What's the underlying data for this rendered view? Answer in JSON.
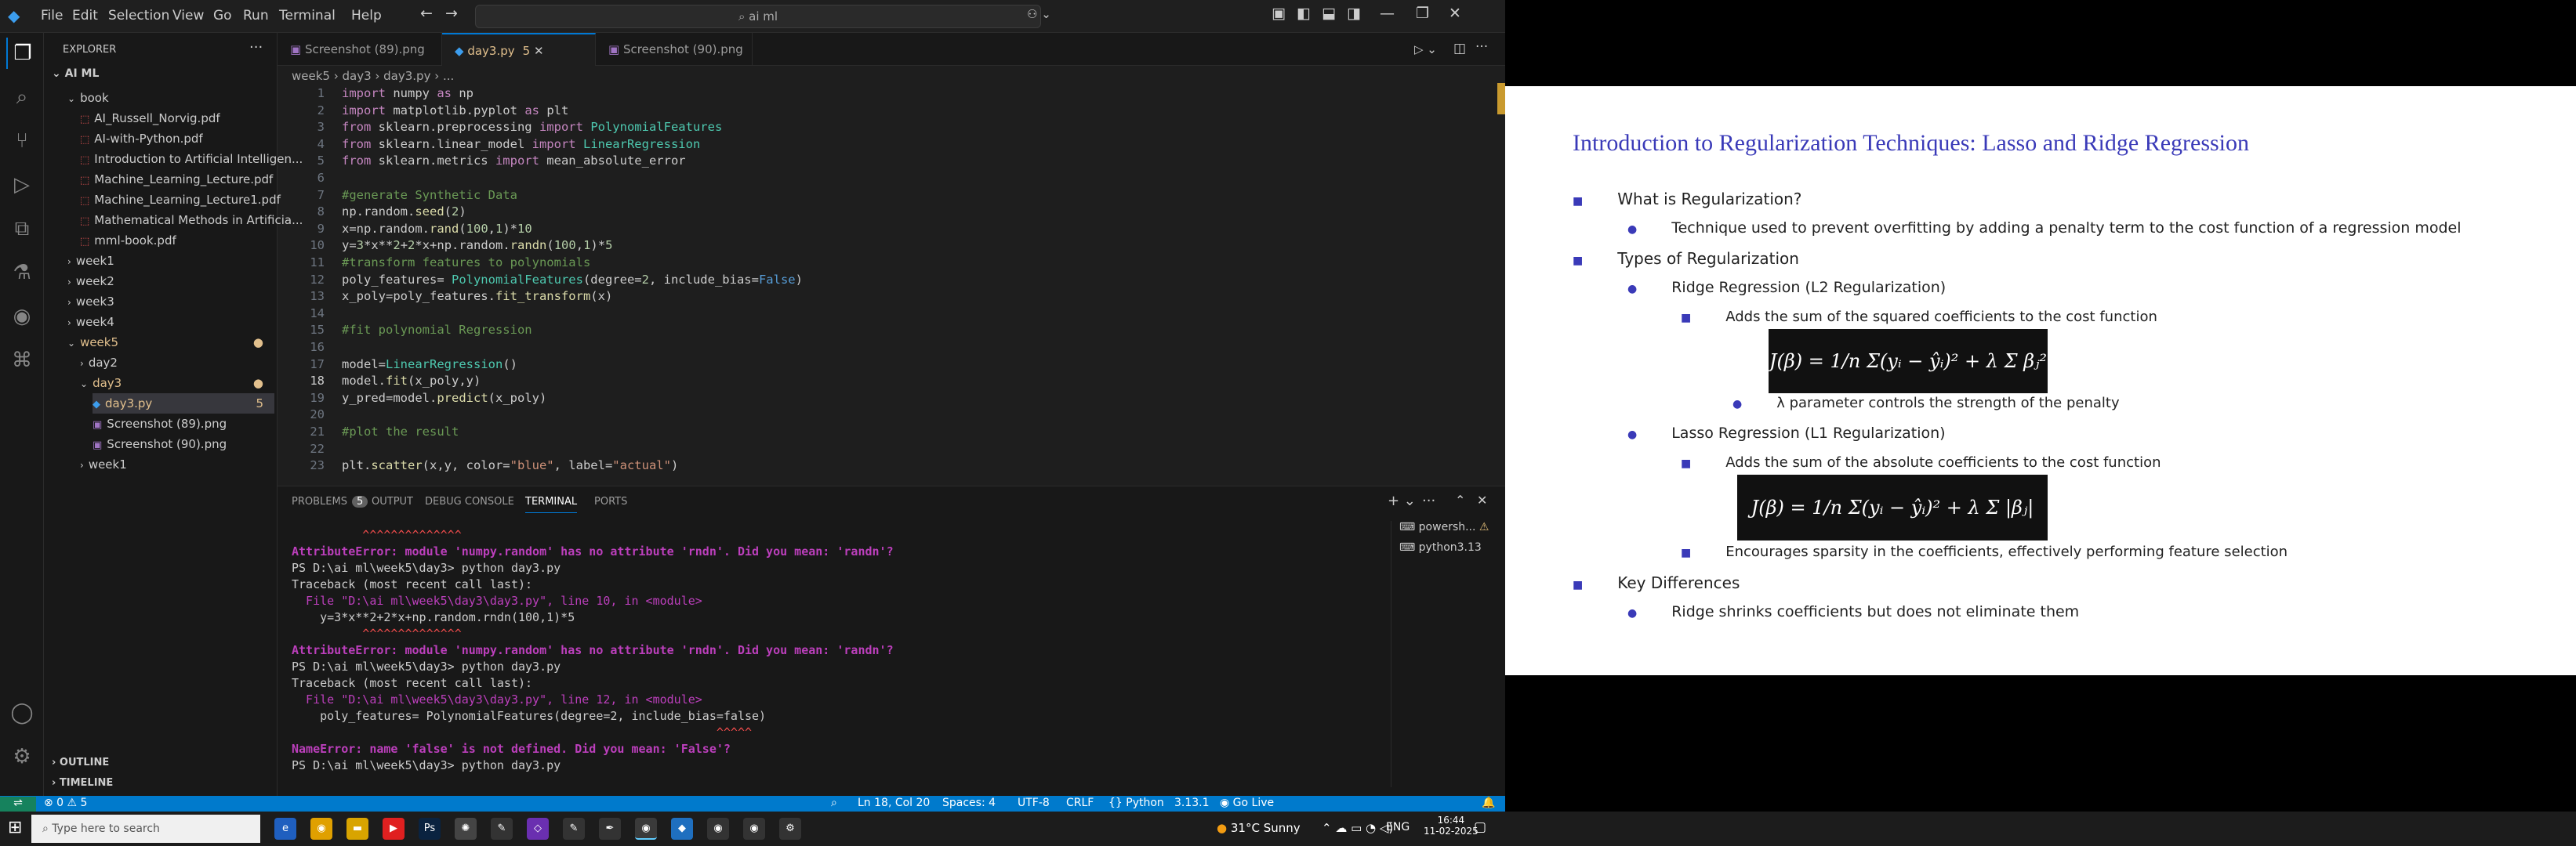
{
  "window": {
    "search": "ai ml"
  },
  "menu": [
    "File",
    "Edit",
    "Selection",
    "View",
    "Go",
    "Run",
    "Terminal",
    "Help"
  ],
  "explorer": {
    "header": "EXPLORER",
    "workspace": "AI ML",
    "items": [
      {
        "label": "book",
        "kind": "folder-open",
        "indent": 1
      },
      {
        "label": "AI_Russell_Norvig.pdf",
        "kind": "pdf",
        "indent": 2
      },
      {
        "label": "AI-with-Python.pdf",
        "kind": "pdf",
        "indent": 2
      },
      {
        "label": "Introduction to Artificial Intelligen...",
        "kind": "pdf",
        "indent": 2
      },
      {
        "label": "Machine_Learning_Lecture.pdf",
        "kind": "pdf",
        "indent": 2
      },
      {
        "label": "Machine_Learning_Lecture1.pdf",
        "kind": "pdf",
        "indent": 2
      },
      {
        "label": "Mathematical Methods in Artificia...",
        "kind": "pdf",
        "indent": 2
      },
      {
        "label": "mml-book.pdf",
        "kind": "pdf",
        "indent": 2
      },
      {
        "label": "week1",
        "kind": "folder",
        "indent": 1
      },
      {
        "label": "week2",
        "kind": "folder",
        "indent": 1
      },
      {
        "label": "week3",
        "kind": "folder",
        "indent": 1
      },
      {
        "label": "week4",
        "kind": "folder",
        "indent": 1
      },
      {
        "label": "week5",
        "kind": "folder-open",
        "indent": 1
      },
      {
        "label": "day2",
        "kind": "folder",
        "indent": 2
      },
      {
        "label": "day3",
        "kind": "folder-open",
        "indent": 2
      },
      {
        "label": "day3.py",
        "kind": "py",
        "indent": 3,
        "badge": "5"
      },
      {
        "label": "Screenshot (89).png",
        "kind": "png",
        "indent": 3
      },
      {
        "label": "Screenshot (90).png",
        "kind": "png",
        "indent": 3
      },
      {
        "label": "week1",
        "kind": "folder",
        "indent": 2
      }
    ],
    "outline": "OUTLINE",
    "timeline": "TIMELINE"
  },
  "tabs": [
    {
      "label": "Screenshot (89).png"
    },
    {
      "label": "day3.py",
      "badge": "5",
      "active": true
    },
    {
      "label": "Screenshot (90).png"
    }
  ],
  "breadcrumb": "week5 › day3 › day3.py › ...",
  "code": [
    "import numpy as np",
    "import matplotlib.pyplot as plt",
    "from sklearn.preprocessing import PolynomialFeatures",
    "from sklearn.linear_model import LinearRegression",
    "from sklearn.metrics import mean_absolute_error",
    "",
    "#generate Synthetic Data",
    "np.random.seed(2)",
    "x=np.random.rand(100,1)*10",
    "y=3*x**2+2*x+np.random.randn(100,1)*5",
    "#transform features to polynomials",
    "poly_features= PolynomialFeatures(degree=2, include_bias=False)",
    "x_poly=poly_features.fit_transform(x)",
    "",
    "#fit polynomial Regression",
    "",
    "model=LinearRegression()",
    "model.fit(x_poly,y)",
    "y_pred=model.predict(x_poly)",
    "",
    "#plot the result",
    "",
    "plt.scatter(x,y, color=\"blue\", label=\"actual\")"
  ],
  "panel": {
    "tabs": [
      "PROBLEMS",
      "OUTPUT",
      "DEBUG CONSOLE",
      "TERMINAL",
      "PORTS"
    ],
    "problems_count": "5",
    "terminals": [
      "powersh...",
      "python3.13"
    ],
    "lines": [
      "          ^^^^^^^^^^^^^^",
      "AttributeError: module 'numpy.random' has no attribute 'rndn'. Did you mean: 'randn'?",
      "PS D:\\ai ml\\week5\\day3> python day3.py",
      "Traceback (most recent call last):",
      "  File \"D:\\ai ml\\week5\\day3\\day3.py\", line 10, in <module>",
      "    y=3*x**2+2*x+np.random.rndn(100,1)*5",
      "          ^^^^^^^^^^^^^^",
      "AttributeError: module 'numpy.random' has no attribute 'rndn'. Did you mean: 'randn'?",
      "PS D:\\ai ml\\week5\\day3> python day3.py",
      "Traceback (most recent call last):",
      "  File \"D:\\ai ml\\week5\\day3\\day3.py\", line 12, in <module>",
      "    poly_features= PolynomialFeatures(degree=2, include_bias=false)",
      "                                                            ^^^^^",
      "NameError: name 'false' is not defined. Did you mean: 'False'?",
      "PS D:\\ai ml\\week5\\day3> python day3.py"
    ]
  },
  "status": {
    "problems": "⊗ 0 ⚠ 5",
    "position": "Ln 18, Col 20",
    "spaces": "Spaces: 4",
    "encoding": "UTF-8",
    "eol": "CRLF",
    "language": "{} Python",
    "version": "3.13.1",
    "golive": "Go Live"
  },
  "slide": {
    "title": "Introduction to Regularization Techniques: Lasso and Ridge Regression",
    "b1": "What is Regularization?",
    "b1a": "Technique used to prevent overfitting by adding a penalty term to the cost function of a regression model",
    "b2": "Types of Regularization",
    "ridge": "Ridge Regression (L2 Regularization)",
    "ridge_desc": "Adds the sum of the squared coefficients to the cost function",
    "ridge_formula": "J(β) = 1/n Σ(yᵢ − ŷᵢ)² + λ Σ βⱼ²",
    "lambda": "λ parameter controls the strength of the penalty",
    "lasso": "Lasso Regression (L1 Regularization)",
    "lasso_desc": "Adds the sum of the absolute coefficients to the cost function",
    "lasso_formula": "J(β) = 1/n Σ(yᵢ − ŷᵢ)² + λ Σ |βⱼ|",
    "sparsity": "Encourages sparsity in the coefficients, effectively performing feature selection",
    "b3": "Key Differences",
    "b3a": "Ridge shrinks coefficients but does not eliminate them"
  },
  "taskbar": {
    "search_placeholder": "Type here to search",
    "weather": "31°C  Sunny",
    "lang": "ENG",
    "time": "16:44",
    "date": "11-02-2025"
  }
}
